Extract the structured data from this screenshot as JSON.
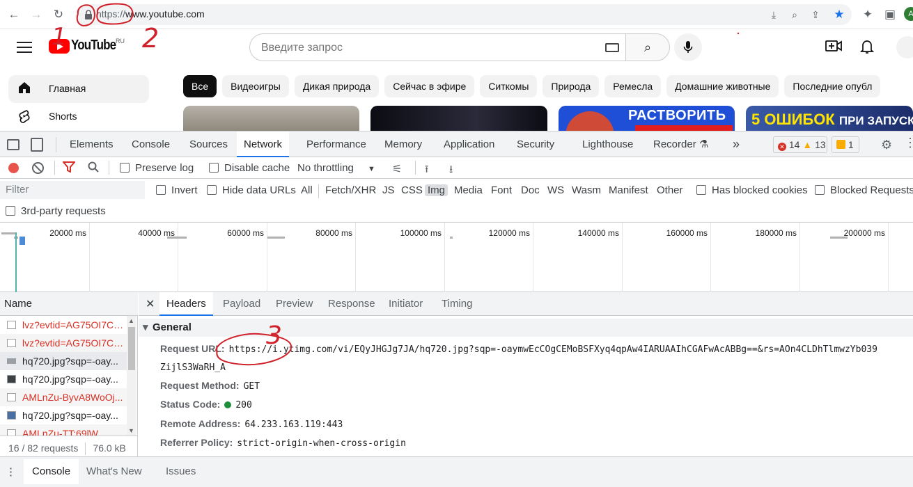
{
  "browser": {
    "url_scheme": "https://",
    "url_host": "www.youtube.com",
    "profile_initial": "A"
  },
  "youtube": {
    "country_code": "RU",
    "logo_text": "YouTube",
    "search_placeholder": "Введите запрос",
    "nav": [
      {
        "label": "Главная",
        "icon": "home-icon"
      },
      {
        "label": "Shorts",
        "icon": "shorts-icon"
      }
    ],
    "chips": [
      "Все",
      "Видеоигры",
      "Дикая природа",
      "Сейчас в эфире",
      "Ситкомы",
      "Природа",
      "Ремесла",
      "Домашние животные",
      "Последние опубл"
    ],
    "thumbnails": [
      {
        "text": ""
      },
      {
        "text": ""
      },
      {
        "text": "РАСТВОРИТЬ"
      },
      {
        "text": "5 ОШИБОК",
        "text2": "ПРИ ЗАПУСКЕ"
      }
    ]
  },
  "devtools": {
    "tabs": [
      "Elements",
      "Console",
      "Sources",
      "Network",
      "Performance",
      "Memory",
      "Application",
      "Security",
      "Lighthouse",
      "Recorder"
    ],
    "active_tab": "Network",
    "more_tabs": "»",
    "errors": "14",
    "warnings": "13",
    "issues": "1",
    "toolbar": {
      "preserve_log": "Preserve log",
      "disable_cache": "Disable cache",
      "throttling": "No throttling"
    },
    "filter": {
      "placeholder": "Filter",
      "invert": "Invert",
      "hide_data_urls": "Hide data URLs",
      "types": [
        "All",
        "Fetch/XHR",
        "JS",
        "CSS",
        "Img",
        "Media",
        "Font",
        "Doc",
        "WS",
        "Wasm",
        "Manifest",
        "Other"
      ],
      "selected_type": "Img",
      "blocked_cookies": "Has blocked cookies",
      "blocked_requests": "Blocked Requests",
      "third_party": "3rd-party requests"
    },
    "timeline_ticks": [
      "20000 ms",
      "40000 ms",
      "60000 ms",
      "80000 ms",
      "100000 ms",
      "120000 ms",
      "140000 ms",
      "160000 ms",
      "180000 ms",
      "200000 ms"
    ],
    "requests": {
      "header": "Name",
      "rows": [
        {
          "name": "lvz?evtid=AG75OI7Cu...",
          "status": "error"
        },
        {
          "name": "lvz?evtid=AG75OI7Cu...",
          "status": "error"
        },
        {
          "name": "hq720.jpg?sqp=-oay...",
          "status": "selected"
        },
        {
          "name": "hq720.jpg?sqp=-oay...",
          "status": "ok"
        },
        {
          "name": "AMLnZu-ByvA8WoOj...",
          "status": "error"
        },
        {
          "name": "hq720.jpg?sqp=-oay...",
          "status": "ok"
        },
        {
          "name": "AMLnZu-TT:69lW...",
          "status": "error"
        }
      ],
      "summary": "16 / 82 requests",
      "size": "76.0 kB"
    },
    "detail_tabs": [
      "Headers",
      "Payload",
      "Preview",
      "Response",
      "Initiator",
      "Timing"
    ],
    "active_detail_tab": "Headers",
    "general": {
      "title": "General",
      "request_url_label": "Request URL:",
      "request_url": "https://i.ytimg.com/vi/EQyJHGJg7JA/hq720.jpg?sqp=-oaymwEcCOgCEMoBSFXyq4qpAw4IARUAAIhCGAFwAcABBg==&rs=AOn4CLDhTlmwzYb039",
      "request_url_cont": "ZijlS3WaRH_A",
      "method_label": "Request Method:",
      "method": "GET",
      "status_label": "Status Code:",
      "status": "200",
      "remote_label": "Remote Address:",
      "remote": "64.233.163.119:443",
      "referrer_label": "Referrer Policy:",
      "referrer": "strict-origin-when-cross-origin"
    },
    "drawer_tabs": [
      "Console",
      "What's New",
      "Issues"
    ],
    "active_drawer_tab": "Console"
  },
  "annotations": [
    "1",
    "2",
    "3"
  ],
  "colors": {
    "annotation": "#d0202a",
    "accent": "#1a73e8",
    "error": "#d93025",
    "yt_red": "#ff0000"
  }
}
